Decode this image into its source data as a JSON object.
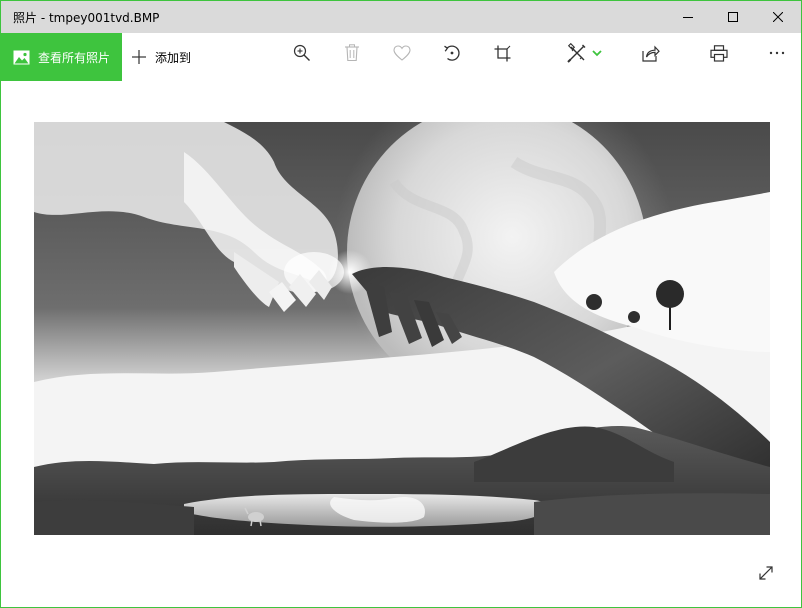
{
  "window": {
    "title": "照片 - tmpey001tvd.BMP"
  },
  "window_controls": {
    "minimize_icon": "minimize-icon",
    "maximize_icon": "maximize-icon",
    "close_icon": "close-icon"
  },
  "toolbar": {
    "see_all_label": "查看所有照片",
    "add_to_label": "添加到",
    "tools": [
      "zoom-in-icon",
      "delete-icon",
      "favorite-icon",
      "rotate-icon",
      "crop-icon",
      "edit-draw-icon",
      "share-icon",
      "print-icon",
      "more-icon"
    ]
  },
  "colors": {
    "accent": "#3ec43e",
    "titlebar": "#dadada",
    "icon": "#333333",
    "icon_disabled": "#b5b5b5"
  },
  "viewer": {
    "fullscreen_icon": "fullscreen-icon"
  }
}
